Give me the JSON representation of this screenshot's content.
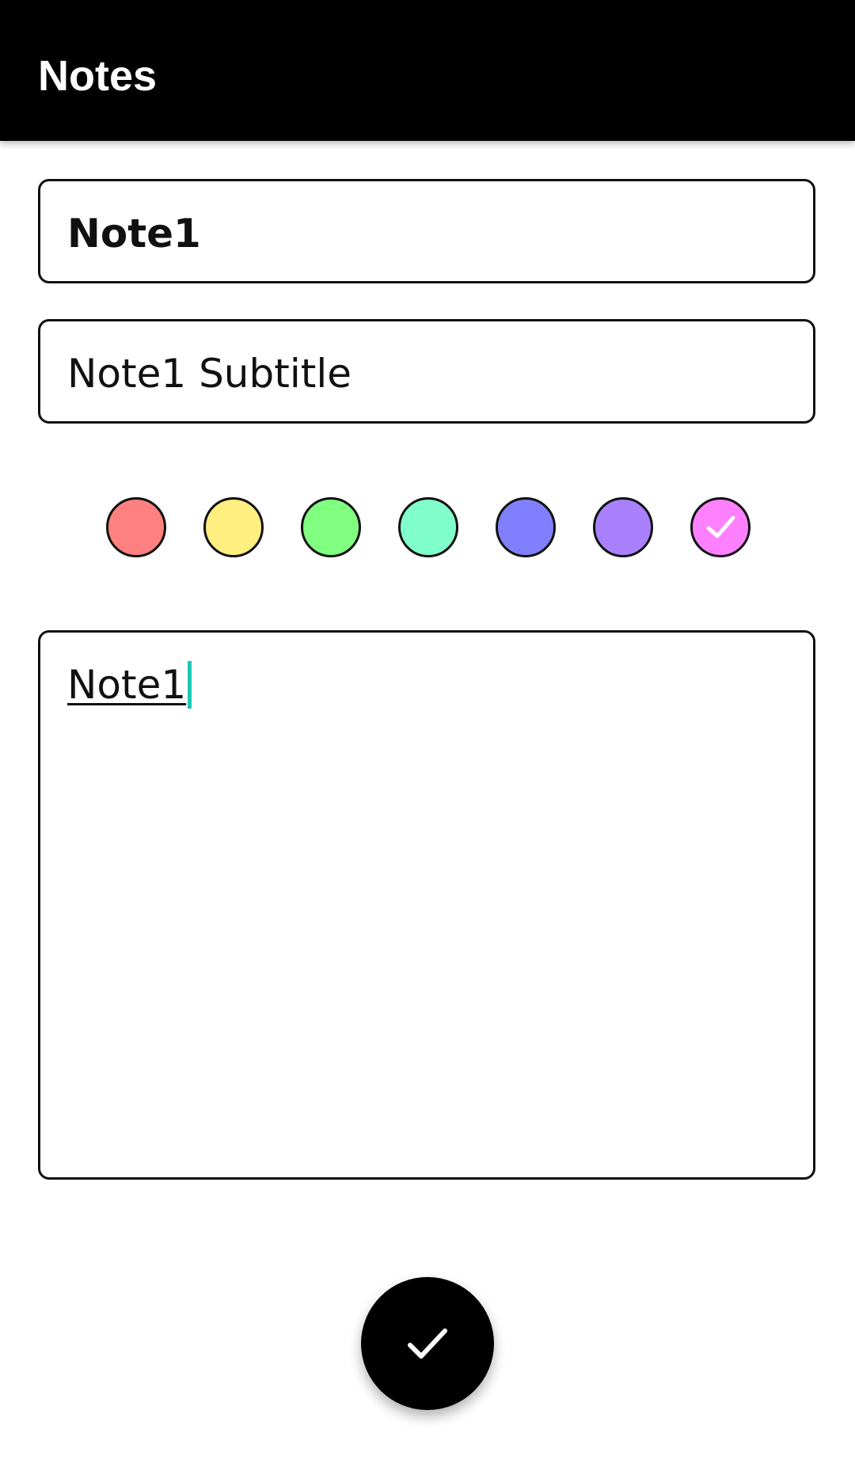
{
  "app_bar": {
    "title": "Notes",
    "background": "#000000"
  },
  "form": {
    "title_value": "Note1",
    "subtitle_value": "Note1 Subtitle",
    "body_value": "Note1"
  },
  "colors": {
    "options": [
      {
        "name": "red",
        "hex": "#ff8080",
        "selected": false
      },
      {
        "name": "yellow",
        "hex": "#ffee80",
        "selected": false
      },
      {
        "name": "green",
        "hex": "#80ff80",
        "selected": false
      },
      {
        "name": "mint",
        "hex": "#80ffcc",
        "selected": false
      },
      {
        "name": "blue",
        "hex": "#8080ff",
        "selected": false
      },
      {
        "name": "purple",
        "hex": "#aa80ff",
        "selected": false
      },
      {
        "name": "pink",
        "hex": "#ff80ff",
        "selected": true
      }
    ],
    "selected_icon": "check-icon",
    "caret_color": "#1ec8b4"
  },
  "fab": {
    "icon": "check-icon",
    "background": "#000000"
  }
}
